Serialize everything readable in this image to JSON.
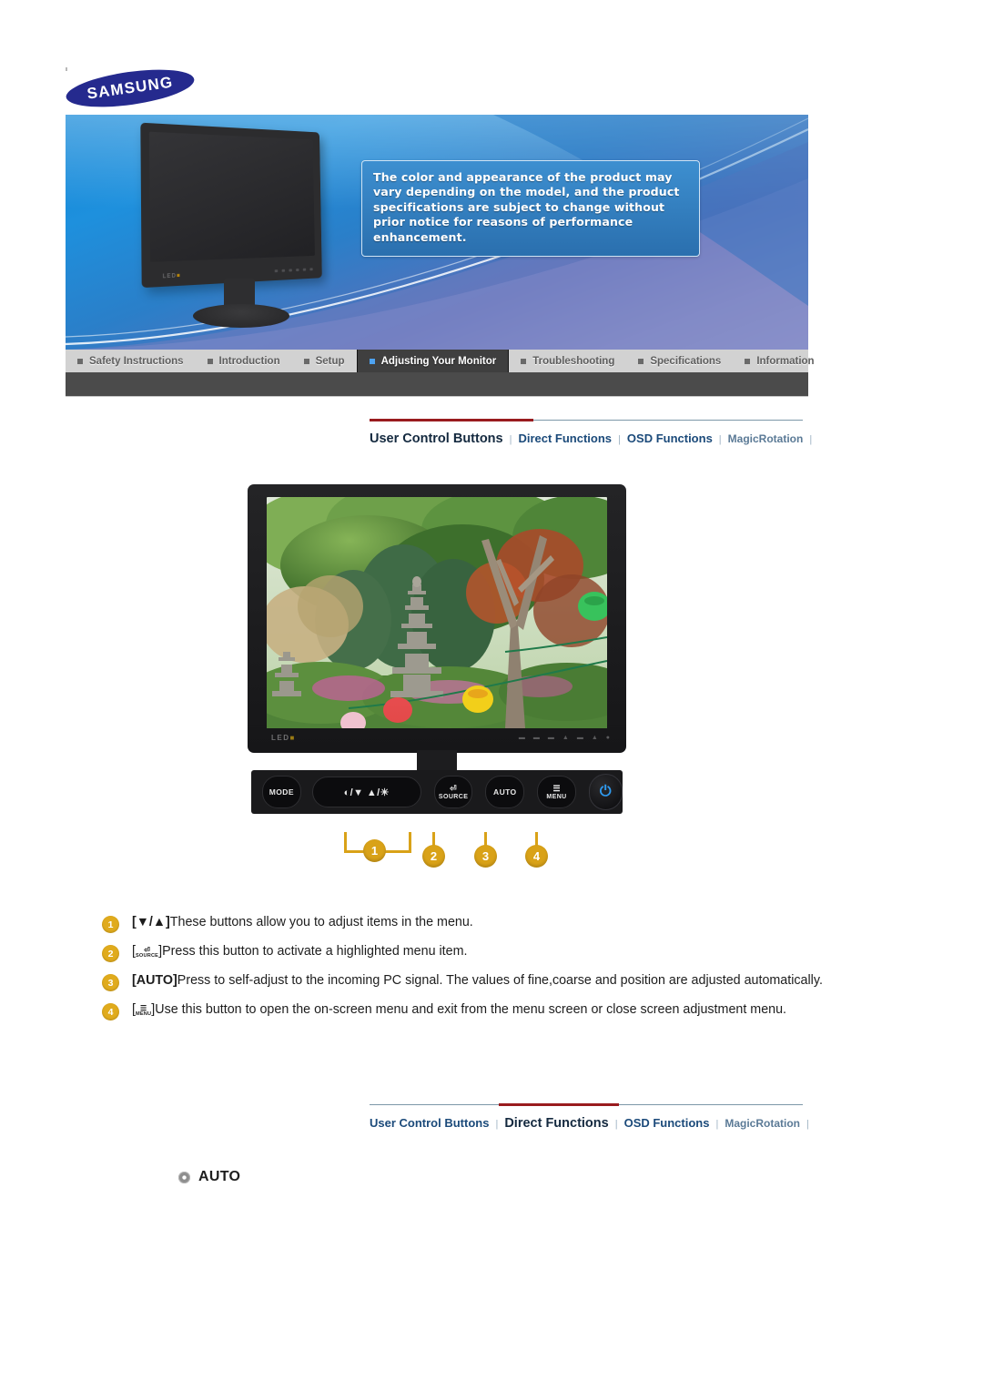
{
  "brand": {
    "logo_text": "SAMSUNG"
  },
  "banner": {
    "note_text": "The color and appearance of the product may vary depending on the model, and the product specifications are subject to change without prior notice for reasons of performance enhancement.",
    "monitor_brand_label": "LED",
    "accent_blue": "#1e90dd",
    "logo_navy": "#252a8e"
  },
  "tabs": [
    {
      "label": "Safety Instructions",
      "active": false
    },
    {
      "label": "Introduction",
      "active": false
    },
    {
      "label": "Setup",
      "active": false
    },
    {
      "label": "Adjusting Your Monitor",
      "active": true
    },
    {
      "label": "Troubleshooting",
      "active": false
    },
    {
      "label": "Specifications",
      "active": false
    },
    {
      "label": "Information",
      "active": false
    }
  ],
  "subnav_top": {
    "items": [
      {
        "label": "User Control Buttons",
        "state": "active"
      },
      {
        "label": "Direct Functions",
        "state": "normal"
      },
      {
        "label": "OSD Functions",
        "state": "normal"
      },
      {
        "label": "MagicRotation",
        "state": "dim"
      }
    ],
    "separator": "|",
    "highlight_color": "#991b1e"
  },
  "subnav_bottom": {
    "items": [
      {
        "label": "User Control Buttons",
        "state": "normal"
      },
      {
        "label": "Direct Functions",
        "state": "active"
      },
      {
        "label": "OSD Functions",
        "state": "normal"
      },
      {
        "label": "MagicRotation",
        "state": "dim"
      }
    ],
    "separator": "|",
    "highlight_color": "#991b1e"
  },
  "figure": {
    "led_label": "LED",
    "bezel_marks": "— –’ –’ ▲ — ▲ ●",
    "buttons": [
      {
        "name": "mode",
        "label": "MODE"
      },
      {
        "name": "down-up",
        "label": "◐/▼        ▲/☀"
      },
      {
        "name": "source",
        "glyph": "⏎",
        "label": "SOURCE"
      },
      {
        "name": "auto",
        "label": "AUTO"
      },
      {
        "name": "menu",
        "glyph": "☰",
        "label": "MENU"
      },
      {
        "name": "power",
        "glyph": "⏻",
        "label": ""
      }
    ],
    "callouts": [
      "1",
      "2",
      "3",
      "4"
    ],
    "callout_color": "#d9a218"
  },
  "items": [
    {
      "num": "1",
      "prefix": "[▼/▲]",
      "text": "These buttons allow you to adjust items in the menu."
    },
    {
      "num": "2",
      "prefix": "[",
      "keycap_glyph": "⏎",
      "keycap_label": "SOURCE",
      "suffix": "]",
      "text": "Press this button to activate a highlighted menu item."
    },
    {
      "num": "3",
      "prefix": "[AUTO]",
      "text": "Press to self-adjust to the incoming PC signal. The values of fine,coarse and position are adjusted automatically."
    },
    {
      "num": "4",
      "prefix": "[",
      "keycap_glyph": "☰",
      "keycap_label": "MENU",
      "suffix": "]",
      "text": "Use this button to open the on-screen menu and exit from the menu screen or close screen adjustment menu."
    }
  ],
  "auto_section": {
    "title": "AUTO",
    "bullet": "gear-bullet-icon"
  }
}
